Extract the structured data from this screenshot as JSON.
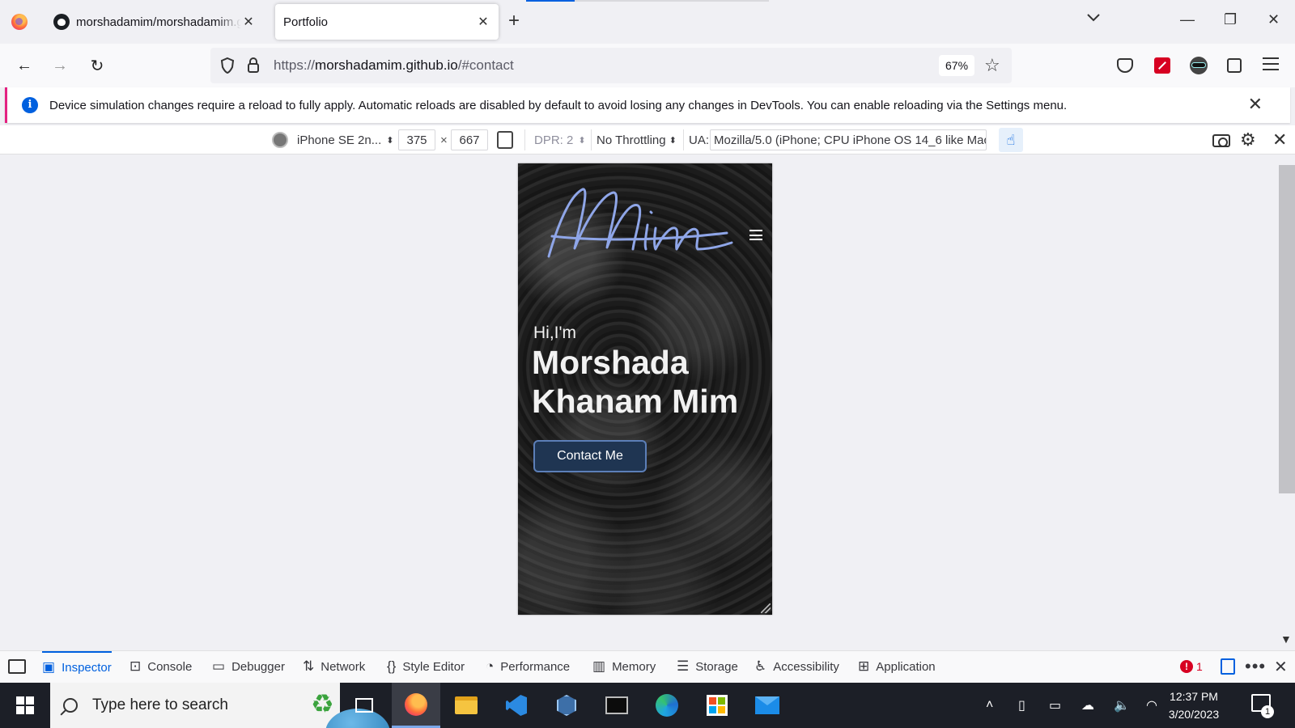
{
  "browser": {
    "tabs": [
      {
        "title": "morshadamim/morshadamim.github.io",
        "icon": "github-icon",
        "active": false
      },
      {
        "title": "Portfolio",
        "active": true
      }
    ],
    "url": {
      "scheme": "https://",
      "host": "morshadamim.github.io",
      "path": "/#contact"
    },
    "zoom": "67%"
  },
  "infobar": {
    "message": "Device simulation changes require a reload to fully apply. Automatic reloads are disabled by default to avoid losing any changes in DevTools. You can enable reloading via the Settings menu."
  },
  "rdm": {
    "device": "iPhone SE 2n...",
    "width": "375",
    "times": "×",
    "height": "667",
    "dpr": "DPR: 2",
    "throttling": "No Throttling",
    "ua_label": "UA:",
    "ua": "Mozilla/5.0 (iPhone; CPU iPhone OS 14_6 like Mac"
  },
  "site": {
    "logo_text": "Mim",
    "greeting": "Hi,I'm",
    "name_line1": "Morshada",
    "name_line2": "Khanam Mim",
    "cta": "Contact Me"
  },
  "devtools": {
    "tabs": [
      {
        "label": "Inspector",
        "icon": "inspector-icon",
        "active": true
      },
      {
        "label": "Console",
        "icon": "console-icon"
      },
      {
        "label": "Debugger",
        "icon": "debugger-icon"
      },
      {
        "label": "Network",
        "icon": "network-icon"
      },
      {
        "label": "Style Editor",
        "icon": "style-editor-icon"
      },
      {
        "label": "Performance",
        "icon": "performance-icon"
      },
      {
        "label": "Memory",
        "icon": "memory-icon"
      },
      {
        "label": "Storage",
        "icon": "storage-icon"
      },
      {
        "label": "Accessibility",
        "icon": "accessibility-icon"
      },
      {
        "label": "Application",
        "icon": "application-icon"
      }
    ],
    "error_count": "1"
  },
  "taskbar": {
    "search_placeholder": "Type here to search",
    "time": "12:37 PM",
    "date": "3/20/2023",
    "notification_count": "1"
  },
  "colors": {
    "accent": "#0060df",
    "infobar_stripe": "#e32181",
    "logo_blue": "#8fa6e8",
    "button_bg": "#1f3552"
  }
}
